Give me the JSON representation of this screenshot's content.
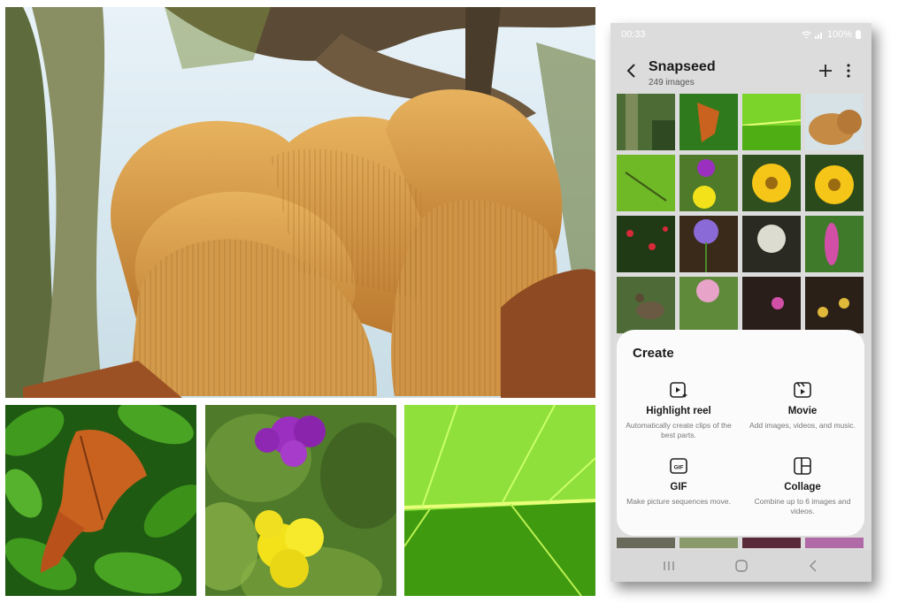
{
  "status_bar": {
    "time": "00:33",
    "battery": "100%"
  },
  "album": {
    "title": "Snapseed",
    "count": "249 images"
  },
  "toolbar": {
    "back_icon": "chevron-left-icon",
    "add_icon": "plus-icon",
    "more_icon": "more-vertical-icon"
  },
  "create_sheet": {
    "title": "Create",
    "options": [
      {
        "label": "Highlight reel",
        "description": "Automatically create clips of the best parts.",
        "icon": "play-sparkle-icon"
      },
      {
        "label": "Movie",
        "description": "Add images, videos, and music.",
        "icon": "clapper-icon"
      },
      {
        "label": "GIF",
        "description": "Make picture sequences move.",
        "icon": "gif-icon"
      },
      {
        "label": "Collage",
        "description": "Combine up to 6 images and videos.",
        "icon": "collage-icon"
      }
    ]
  },
  "nav_bar": {
    "recents_icon": "recents-icon",
    "home_icon": "home-icon",
    "back_icon": "back-icon"
  },
  "colors": {
    "sheet_background": "#fbfbfb",
    "phone_background": "#dcdcdc",
    "text_primary": "#1a1a1a",
    "text_secondary": "#777777"
  }
}
